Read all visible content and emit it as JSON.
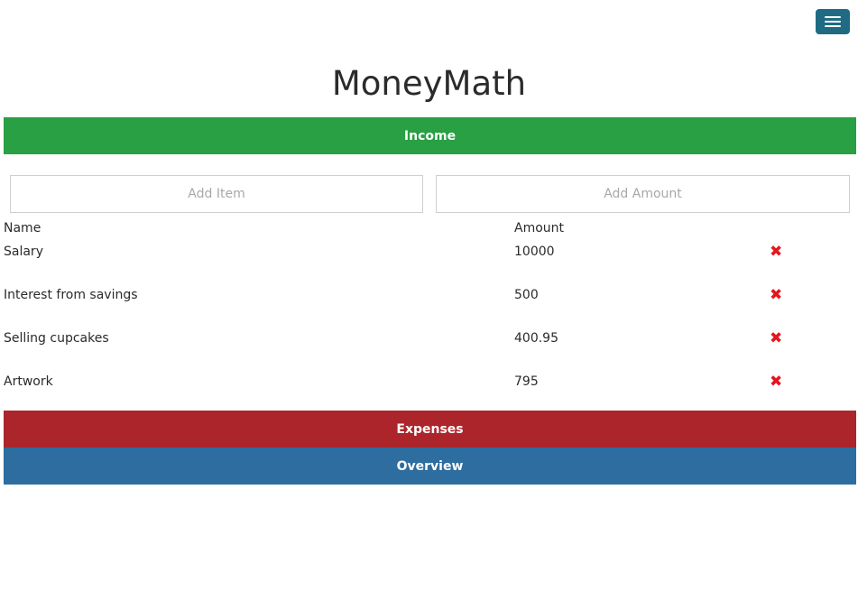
{
  "header": {
    "menu_icon": "hamburger-menu-icon",
    "title": "MoneyMath"
  },
  "sections": {
    "income_label": "Income",
    "expenses_label": "Expenses",
    "overview_label": "Overview"
  },
  "form": {
    "item_placeholder": "Add Item",
    "amount_placeholder": "Add Amount",
    "item_value": "",
    "amount_value": ""
  },
  "table": {
    "headers": {
      "name": "Name",
      "amount": "Amount"
    },
    "rows": [
      {
        "name": "Salary",
        "amount": "10000",
        "delete_icon": "✖"
      },
      {
        "name": "Interest from savings",
        "amount": "500",
        "delete_icon": "✖"
      },
      {
        "name": "Selling cupcakes",
        "amount": "400.95",
        "delete_icon": "✖"
      },
      {
        "name": "Artwork",
        "amount": "795",
        "delete_icon": "✖"
      }
    ]
  },
  "colors": {
    "income": "#28a043",
    "expenses": "#ab252a",
    "overview": "#2e6da0",
    "menu_button": "#1f6b84",
    "delete_icon": "#e5151e"
  }
}
